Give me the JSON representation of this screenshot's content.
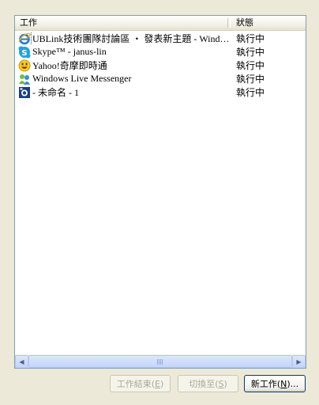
{
  "columns": {
    "task": "工作",
    "status": "狀態"
  },
  "tasks": [
    {
      "label": "UBLink技術團隊討論區 ‧ 發表新主題 - Windows Internet Explorer",
      "status": "執行中",
      "icon": "ie-icon",
      "selected": true
    },
    {
      "label": "Skype™ - janus-lin",
      "status": "執行中",
      "icon": "skype-icon"
    },
    {
      "label": "Yahoo!奇摩即時通",
      "status": "執行中",
      "icon": "yahoo-messenger-icon"
    },
    {
      "label": "Windows Live Messenger",
      "status": "執行中",
      "icon": "msn-icon"
    },
    {
      "label": " - 未命名 - 1",
      "status": "執行中",
      "icon": "camera-app-icon"
    }
  ],
  "buttons": {
    "end_task": {
      "text": "工作結束(",
      "key": "E",
      "close": ")"
    },
    "switch_to": {
      "text": "切換至(",
      "key": "S",
      "close": ")"
    },
    "new_task": {
      "text": "新工作(",
      "key": "N",
      "close": ")..."
    }
  },
  "scrollbar": {
    "left": "◀",
    "right": "▶"
  }
}
